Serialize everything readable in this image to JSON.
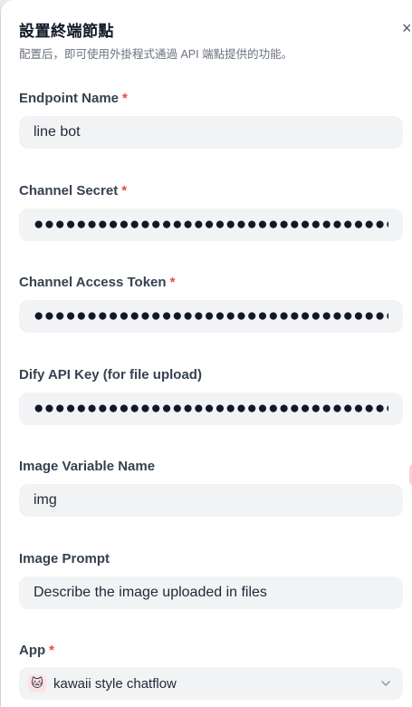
{
  "header": {
    "title": "設置終端節點",
    "subtitle": "配置后，即可使用外掛程式通過 API 端點提供的功能。",
    "close_glyph": "×"
  },
  "required_mark": "*",
  "fields": {
    "endpoint_name": {
      "label": "Endpoint Name",
      "value": "line bot"
    },
    "channel_secret": {
      "label": "Channel Secret",
      "value": "●●●●●●●●●●●●●●●●●●●●●●●●●●●●●●●●●●●●"
    },
    "channel_access_token": {
      "label": "Channel Access Token",
      "value": "●●●●●●●●●●●●●●●●●●●●●●●●●●●●●●●●●●●●"
    },
    "dify_api_key": {
      "label": "Dify API Key (for file upload)",
      "value": "●●●●●●●●●●●●●●●●●●●●●●●●●●●●●●●●●●●●"
    },
    "image_variable_name": {
      "label": "Image Variable Name",
      "value": "img"
    },
    "image_prompt": {
      "label": "Image Prompt",
      "value": "Describe the image uploaded in files"
    },
    "app": {
      "label": "App",
      "value": "kawaii style chatflow",
      "icon": "🐱"
    }
  }
}
